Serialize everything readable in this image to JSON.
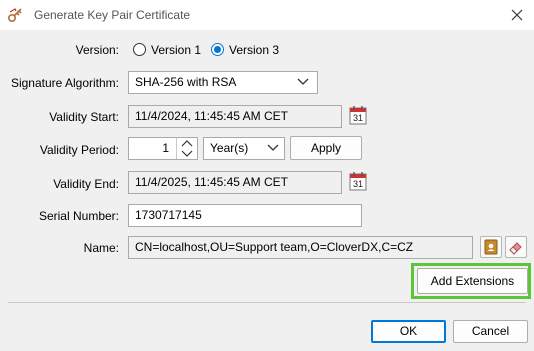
{
  "window": {
    "title": "Generate Key Pair Certificate"
  },
  "version": {
    "label": "Version:",
    "options": [
      "Version 1",
      "Version 3"
    ],
    "selected": "Version 3"
  },
  "signature": {
    "label": "Signature Algorithm:",
    "value": "SHA-256 with RSA"
  },
  "validity_start": {
    "label": "Validity Start:",
    "value": "11/4/2024, 11:45:45 AM CET"
  },
  "validity_period": {
    "label": "Validity Period:",
    "amount": "1",
    "unit": "Year(s)",
    "apply_label": "Apply"
  },
  "validity_end": {
    "label": "Validity End:",
    "value": "11/4/2025, 11:45:45 AM CET"
  },
  "serial": {
    "label": "Serial Number:",
    "value": "1730717145"
  },
  "name": {
    "label": "Name:",
    "value": "CN=localhost,OU=Support team,O=CloverDX,C=CZ"
  },
  "buttons": {
    "add_extensions": "Add Extensions",
    "ok": "OK",
    "cancel": "Cancel"
  },
  "calendar": {
    "day": "31"
  },
  "colors": {
    "highlight": "#5ac73a",
    "accent": "#0078d7"
  }
}
